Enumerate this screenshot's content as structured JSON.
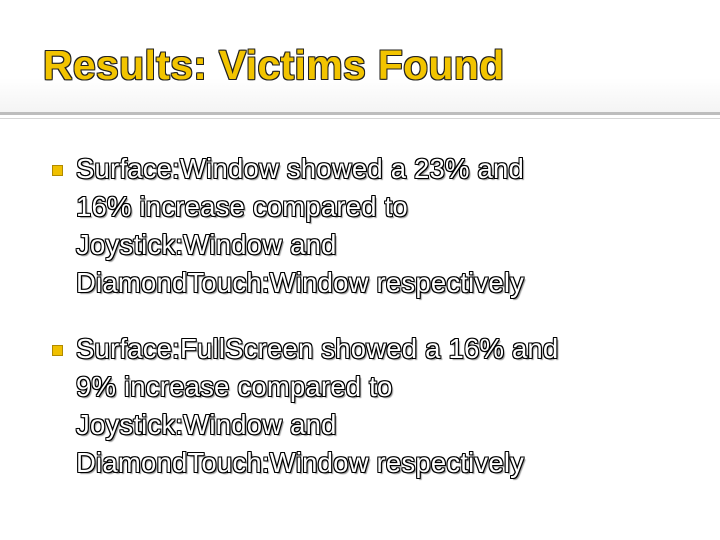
{
  "slide": {
    "title": "Results: Victims Found",
    "title_color": "#f2c400",
    "bullet_color": "#f0c000",
    "bullets": [
      {
        "lines": [
          "Surface:Window showed a 23% and",
          "16% increase compared to",
          "Joystick:Window and",
          "DiamondTouch:Window respectively"
        ]
      },
      {
        "lines": [
          "Surface:FullScreen showed a 16% and",
          "9% increase compared to",
          "Joystick:Window and",
          "DiamondTouch:Window respectively"
        ]
      }
    ]
  }
}
